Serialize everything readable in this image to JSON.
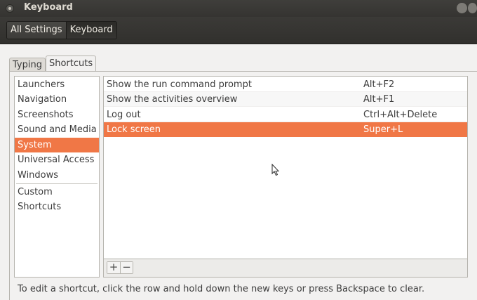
{
  "window": {
    "title": "Keyboard"
  },
  "breadcrumb": {
    "items": [
      "All Settings",
      "Keyboard"
    ]
  },
  "tabs": [
    "Typing",
    "Shortcuts"
  ],
  "active_tab": "Shortcuts",
  "categories": [
    "Launchers",
    "Navigation",
    "Screenshots",
    "Sound and Media",
    "System",
    "Universal Access",
    "Windows",
    "Custom Shortcuts"
  ],
  "selected_category": "System",
  "shortcuts": [
    {
      "name": "Show the run command prompt",
      "accel": "Alt+F2"
    },
    {
      "name": "Show the activities overview",
      "accel": "Alt+F1"
    },
    {
      "name": "Log out",
      "accel": "Ctrl+Alt+Delete"
    },
    {
      "name": "Lock screen",
      "accel": "Super+L"
    }
  ],
  "selected_shortcut": "Lock screen",
  "list_toolbar": {
    "add": "+",
    "remove": "−"
  },
  "hint": "To edit a shortcut, click the row and hold down the new keys or press Backspace to clear.",
  "colors": {
    "accent": "#f07746",
    "titlebar": "#3c3b37",
    "background": "#f2f1f0"
  },
  "icons": {
    "window_menu": "window-menu-icon",
    "add": "plus-icon",
    "remove": "minus-icon",
    "cursor": "mouse-pointer-icon"
  }
}
